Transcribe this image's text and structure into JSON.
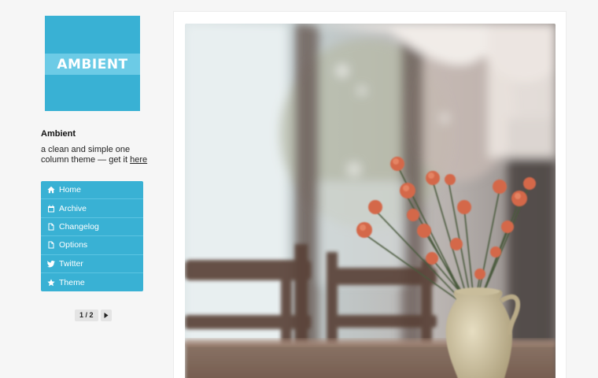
{
  "blog": {
    "logo_text": "AMBIENT",
    "title": "Ambient",
    "description_prefix": "a clean and simple one column theme — get it ",
    "description_link": "here"
  },
  "nav": {
    "items": [
      {
        "label": "Home",
        "icon": "home-icon"
      },
      {
        "label": "Archive",
        "icon": "calendar-icon"
      },
      {
        "label": "Changelog",
        "icon": "file-icon"
      },
      {
        "label": "Options",
        "icon": "file-icon"
      },
      {
        "label": "Twitter",
        "icon": "twitter-icon"
      },
      {
        "label": "Theme",
        "icon": "star-icon"
      }
    ]
  },
  "pagination": {
    "label": "1 / 2"
  },
  "colors": {
    "accent": "#39b1d4",
    "logo_band": "#6ccbe6",
    "background": "#f6f6f6"
  }
}
